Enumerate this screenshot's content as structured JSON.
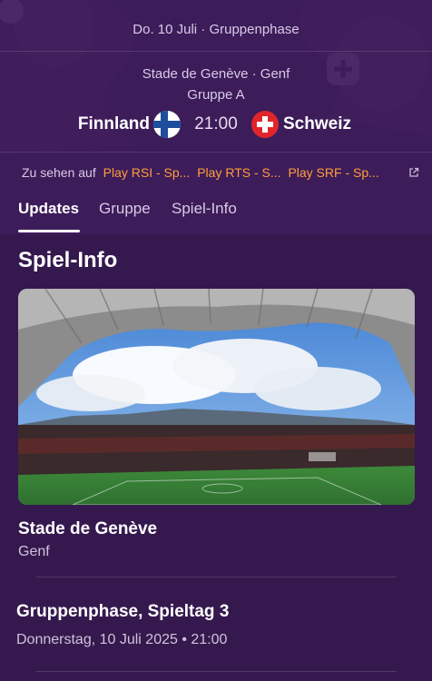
{
  "header": {
    "date_phase": "Do. 10 Juli · Gruppenphase",
    "venue": "Stade de Genève · Genf",
    "group": "Gruppe A",
    "home_team": "Finnland",
    "away_team": "Schweiz",
    "kickoff": "21:00"
  },
  "broadcast": {
    "label": "Zu sehen auf",
    "channels": [
      "Play RSI - Sp...",
      "Play RTS - S...",
      "Play SRF - Sp..."
    ]
  },
  "tabs": [
    "Updates",
    "Gruppe",
    "Spiel-Info"
  ],
  "active_tab": "Updates",
  "section": {
    "title": "Spiel-Info"
  },
  "stadium": {
    "name": "Stade de Genève",
    "city": "Genf"
  },
  "match_info": {
    "phase": "Gruppenphase, Spieltag 3",
    "datetime": "Donnerstag, 10 Juli 2025 • 21:00"
  },
  "colors": {
    "background": "#35194e",
    "header": "#3d1c5a",
    "accent": "#ff9f3a"
  }
}
